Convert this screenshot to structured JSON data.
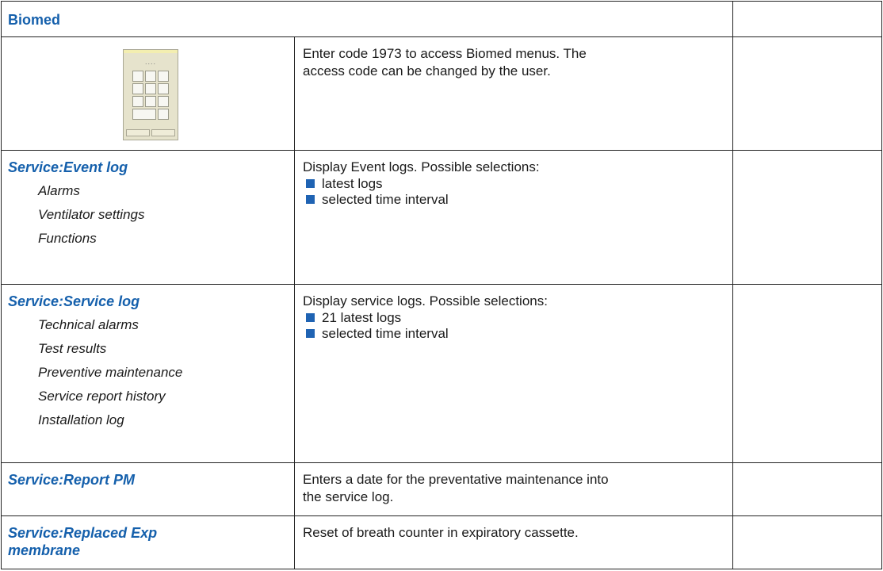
{
  "header": {
    "title": "Biomed"
  },
  "keypad": {
    "icon": "keypad-icon",
    "display_dots": "....",
    "description": [
      "Enter code 1973 to access Biomed menus. The",
      "access code can be changed by the user."
    ]
  },
  "rows": [
    {
      "title": "Service:Event log",
      "subitems": [
        "Alarms",
        "Ventilator settings",
        "Functions"
      ],
      "intro": "Display Event logs. Possible selections:",
      "bullets": [
        "latest logs",
        "selected time interval"
      ]
    },
    {
      "title": "Service:Service log",
      "subitems": [
        "Technical alarms",
        "Test results",
        "Preventive maintenance",
        "Service report history",
        "Installation log"
      ],
      "intro": "Display service logs. Possible selections:",
      "bullets": [
        "21 latest logs",
        "selected time interval"
      ]
    },
    {
      "title": "Service:Report PM",
      "lines": [
        "Enters a date for the preventative maintenance into",
        "the service log."
      ]
    },
    {
      "title_lines": [
        "Service:Replaced Exp",
        "membrane"
      ],
      "lines": [
        "Reset of breath counter in expiratory cassette."
      ]
    }
  ],
  "colors": {
    "accent": "#1560ac",
    "bullet": "#1f63b3",
    "border": "#222222"
  }
}
